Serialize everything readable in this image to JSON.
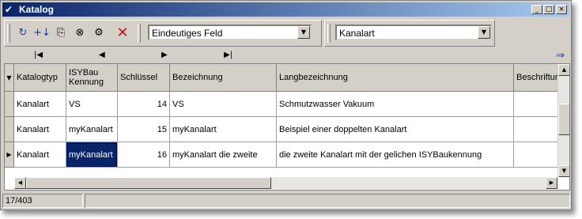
{
  "window": {
    "title": "Katalog"
  },
  "toolbar": {
    "field_combo_value": "Eindeutiges Feld",
    "type_combo_value": "Kanalart"
  },
  "navigator": {
    "first": "|◀",
    "prev": "◀",
    "next": "▶",
    "last": "▶|"
  },
  "grid": {
    "columns": [
      "Katalogtyp",
      "ISYBau Kennung",
      "Schlüssel",
      "Bezeichnung",
      "Langbezeichnung",
      "Beschriftung"
    ],
    "rows": [
      {
        "katalogtyp": "Kanalart",
        "kennung": "VS",
        "schluessel": "14",
        "bezeichnung": "VS",
        "lang": "Schmutzwasser Vakuum",
        "beschriftung": ""
      },
      {
        "katalogtyp": "Kanalart",
        "kennung": "myKanalart",
        "schluessel": "15",
        "bezeichnung": "myKanalart",
        "lang": "Beispiel einer doppelten Kanalart",
        "beschriftung": ""
      },
      {
        "katalogtyp": "Kanalart",
        "kennung": "myKanalart",
        "schluessel": "16",
        "bezeichnung": "myKanalart die zweite",
        "lang": "die zweite Kanalart mit der gelichen ISYBaukennung",
        "beschriftung": ""
      }
    ]
  },
  "status": {
    "record": "17/403"
  }
}
